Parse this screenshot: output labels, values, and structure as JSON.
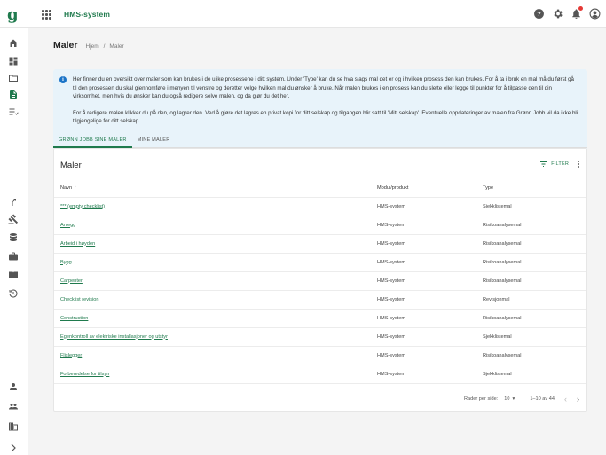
{
  "header": {
    "app_title": "HMS-system",
    "icons": [
      "help-icon",
      "settings-icon",
      "notifications-icon",
      "account-icon"
    ]
  },
  "logo_text": "g",
  "sidenav": {
    "items": [
      "home-icon",
      "dashboard-icon",
      "folder-icon",
      "document-icon",
      "checklist-icon",
      "route-icon",
      "gavel-icon",
      "database-icon",
      "briefcase-icon",
      "book-icon",
      "history-icon",
      "person-icon",
      "group-icon",
      "company-icon",
      "expand-icon"
    ],
    "active": "document-icon"
  },
  "page": {
    "title": "Maler",
    "breadcrumb": [
      "Hjem",
      "Maler"
    ]
  },
  "info": {
    "paragraph1": "Her finner du en oversikt over maler som kan brukes i de ulike prosessene i ditt system. Under 'Type' kan du se hva slags mal det er og i hvilken prosess den kan brukes. For å ta i bruk en mal må du først gå til den prosessen du skal gjennomføre i menyen til venstre og deretter velge hvilken mal du ønsker å bruke. Når malen brukes i en prosess kan du slette eller legge til punkter for å tilpasse den til din virksomhet, men hvis du ønsker kan du også redigere selve malen, og da gjør du det her.",
    "paragraph2": "For å redigere malen klikker du på den, og lagrer den. Ved å gjøre det lagres en privat kopi for ditt selskap og tilgangen blir satt til 'Mitt selskap'. Eventuelle oppdateringer av malen fra Grønn Jobb vil da ikke bli tilgjengelige for ditt selskap."
  },
  "tabs": [
    {
      "label": "GRØNN JOBB SINE MALER",
      "active": true
    },
    {
      "label": "MINE MALER",
      "active": false
    }
  ],
  "table": {
    "title": "Maler",
    "filter_label": "FILTER",
    "columns": [
      "Navn",
      "Modul/produkt",
      "Type"
    ],
    "sort_indicator": "↑",
    "rows": [
      {
        "name": "*** (empty checklist)",
        "module": "HMS-system",
        "type": "Sjekkliste­mal"
      },
      {
        "name": "Anlegg",
        "module": "HMS-system",
        "type": "Risikoanalysemal"
      },
      {
        "name": "Arbeid i høyden",
        "module": "HMS-system",
        "type": "Risikoanalysemal"
      },
      {
        "name": "Bygg",
        "module": "HMS-system",
        "type": "Risikoanalysemal"
      },
      {
        "name": "Carpenter",
        "module": "HMS-system",
        "type": "Risikoanalysemal"
      },
      {
        "name": "Checklist revision",
        "module": "HMS-system",
        "type": "Revisjonmal"
      },
      {
        "name": "Construction",
        "module": "HMS-system",
        "type": "Risikoanalysemal"
      },
      {
        "name": "Egenkontroll av elektriske installasjoner og utstyr",
        "module": "HMS-system",
        "type": "Sjekkliste­mal"
      },
      {
        "name": "Flislegger",
        "module": "HMS-system",
        "type": "Risikoanalysemal"
      },
      {
        "name": "Forberedelse for tilsyn",
        "module": "HMS-system",
        "type": "Sjekkliste­mal"
      }
    ]
  },
  "pagination": {
    "rows_label": "Rader per side:",
    "rows_value": "10",
    "range_label": "1–10 av 44"
  },
  "colors": {
    "accent": "#1f7a4d",
    "info_bg": "#e8f3fa",
    "notification": "#e53935"
  }
}
